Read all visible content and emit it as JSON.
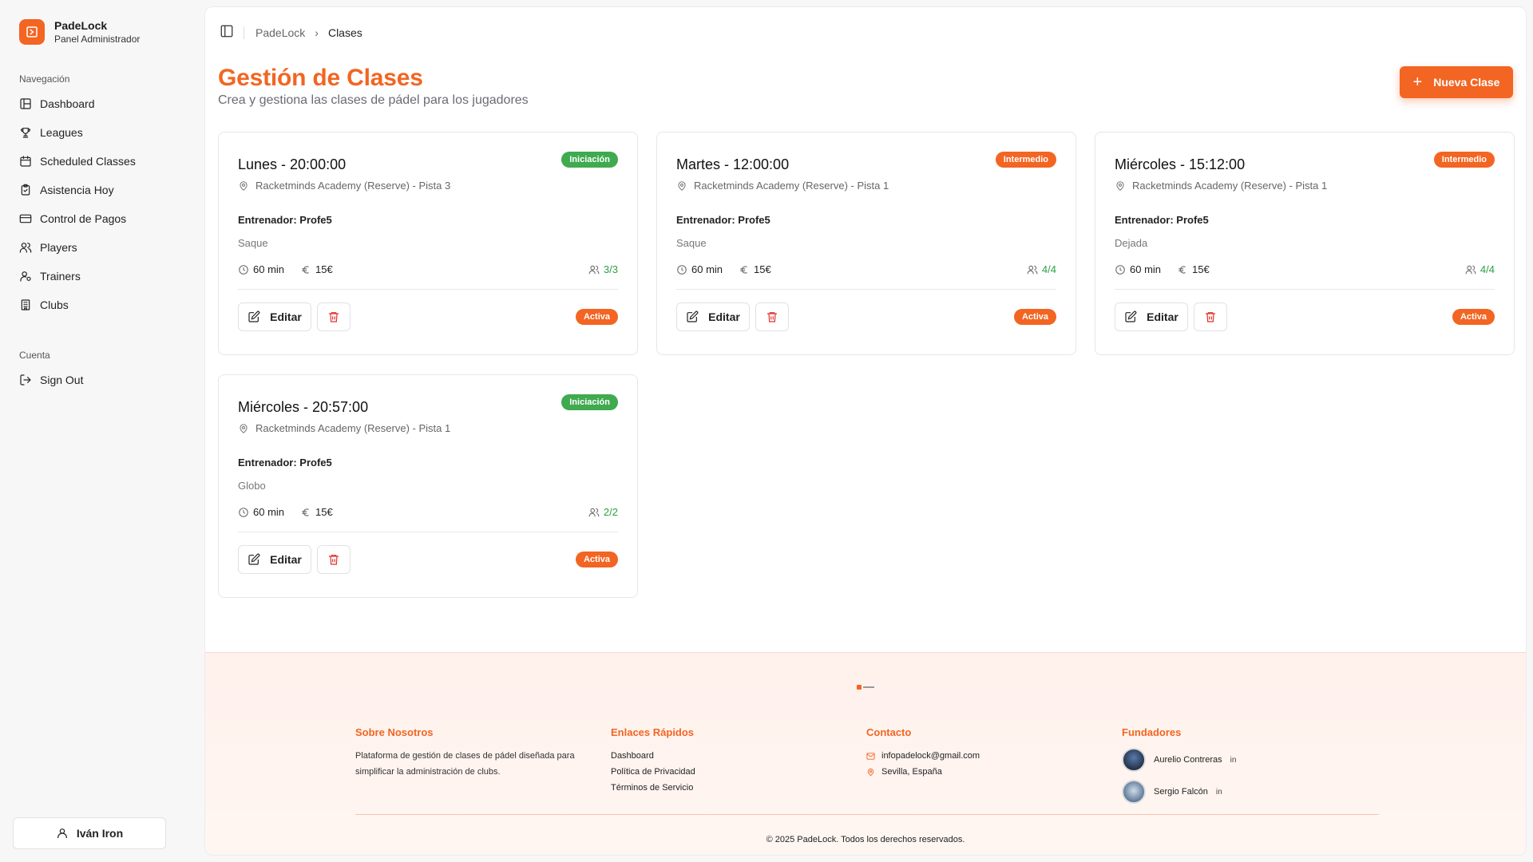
{
  "brand": {
    "name": "PadeLock",
    "subtitle": "Panel Administrador"
  },
  "sidebar": {
    "nav_title": "Navegación",
    "items": [
      {
        "label": "Dashboard",
        "icon": "dashboard-icon"
      },
      {
        "label": "Leagues",
        "icon": "trophy-icon"
      },
      {
        "label": "Scheduled Classes",
        "icon": "calendar-icon"
      },
      {
        "label": "Asistencia Hoy",
        "icon": "clipboard-check-icon"
      },
      {
        "label": "Control de Pagos",
        "icon": "credit-card-icon"
      },
      {
        "label": "Players",
        "icon": "users-icon"
      },
      {
        "label": "Trainers",
        "icon": "user-cog-icon"
      },
      {
        "label": "Clubs",
        "icon": "building-icon"
      }
    ],
    "account_title": "Cuenta",
    "signout": "Sign Out",
    "user": "Iván Iron"
  },
  "breadcrumb": {
    "root": "PadeLock",
    "current": "Clases"
  },
  "page": {
    "title": "Gestión de Clases",
    "subtitle": "Crea y gestiona las clases de pádel para los jugadores",
    "new_button": "Nueva Clase"
  },
  "classes": [
    {
      "title": "Lunes - 20:00:00",
      "level": "Iniciación",
      "level_color": "#3faa4f",
      "location": "Racketminds Academy (Reserve) - Pista 3",
      "trainer": "Entrenador: Profe5",
      "topic": "Saque",
      "duration": "60 min",
      "price": "15€",
      "capacity": "3/3",
      "edit": "Editar",
      "status": "Activa"
    },
    {
      "title": "Martes - 12:00:00",
      "level": "Intermedio",
      "level_color": "#f26522",
      "location": "Racketminds Academy (Reserve) - Pista 1",
      "trainer": "Entrenador: Profe5",
      "topic": "Saque",
      "duration": "60 min",
      "price": "15€",
      "capacity": "4/4",
      "edit": "Editar",
      "status": "Activa"
    },
    {
      "title": "Miércoles - 15:12:00",
      "level": "Intermedio",
      "level_color": "#f26522",
      "location": "Racketminds Academy (Reserve) - Pista 1",
      "trainer": "Entrenador: Profe5",
      "topic": "Dejada",
      "duration": "60 min",
      "price": "15€",
      "capacity": "4/4",
      "edit": "Editar",
      "status": "Activa"
    },
    {
      "title": "Miércoles - 20:57:00",
      "level": "Iniciación",
      "level_color": "#3faa4f",
      "location": "Racketminds Academy (Reserve) - Pista 1",
      "trainer": "Entrenador: Profe5",
      "topic": "Globo",
      "duration": "60 min",
      "price": "15€",
      "capacity": "2/2",
      "edit": "Editar",
      "status": "Activa"
    }
  ],
  "footer": {
    "about_title": "Sobre Nosotros",
    "about_text": "Plataforma de gestión de clases de pádel diseñada para simplificar la administración de clubs.",
    "links_title": "Enlaces Rápidos",
    "links": [
      "Dashboard",
      "Política de Privacidad",
      "Términos de Servicio"
    ],
    "contact_title": "Contacto",
    "email": "infopadelock@gmail.com",
    "address": "Sevilla, España",
    "founders_title": "Fundadores",
    "founders": [
      "Aurelio Contreras",
      "Sergio Falcón"
    ],
    "copyright": "© 2025 PadeLock. Todos los derechos reservados."
  }
}
